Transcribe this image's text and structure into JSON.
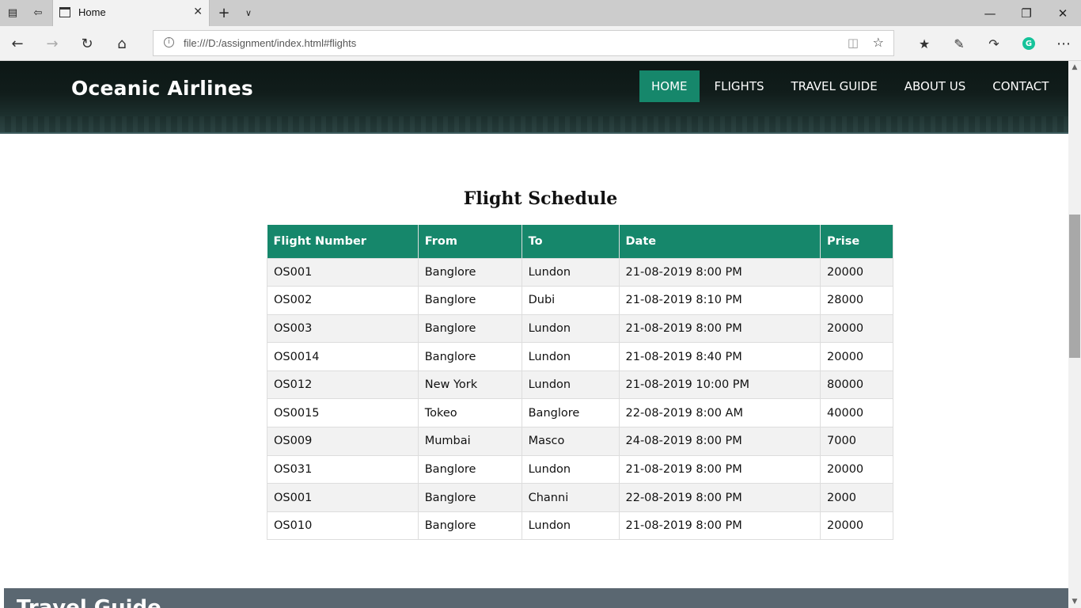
{
  "browser": {
    "tab_title": "Home",
    "url": "file:///D:/assignment/index.html#flights"
  },
  "site": {
    "brand": "Oceanic Airlines",
    "menu": [
      "HOME",
      "FLIGHTS",
      "TRAVEL GUIDE",
      "ABOUT US",
      "CONTACT"
    ],
    "active_menu": "HOME",
    "accent_color": "#16876b"
  },
  "schedule": {
    "title": "Flight Schedule",
    "columns": [
      "Flight Number",
      "From",
      "To",
      "Date",
      "Prise"
    ],
    "rows": [
      [
        "OS001",
        "Banglore",
        "Lundon",
        "21-08-2019 8:00 PM",
        "20000"
      ],
      [
        "OS002",
        "Banglore",
        "Dubi",
        "21-08-2019 8:10 PM",
        "28000"
      ],
      [
        "OS003",
        "Banglore",
        "Lundon",
        "21-08-2019 8:00 PM",
        "20000"
      ],
      [
        "OS0014",
        "Banglore",
        "Lundon",
        "21-08-2019 8:40 PM",
        "20000"
      ],
      [
        "OS012",
        "New York",
        "Lundon",
        "21-08-2019 10:00 PM",
        "80000"
      ],
      [
        "OS0015",
        "Tokeo",
        "Banglore",
        "22-08-2019 8:00 AM",
        "40000"
      ],
      [
        "OS009",
        "Mumbai",
        "Masco",
        "24-08-2019 8:00 PM",
        "7000"
      ],
      [
        "OS031",
        "Banglore",
        "Lundon",
        "21-08-2019 8:00 PM",
        "20000"
      ],
      [
        "OS001",
        "Banglore",
        "Channi",
        "22-08-2019 8:00 PM",
        "2000"
      ],
      [
        "OS010",
        "Banglore",
        "Lundon",
        "21-08-2019 8:00 PM",
        "20000"
      ]
    ]
  },
  "travel_guide": {
    "heading": "Travel Guide"
  }
}
